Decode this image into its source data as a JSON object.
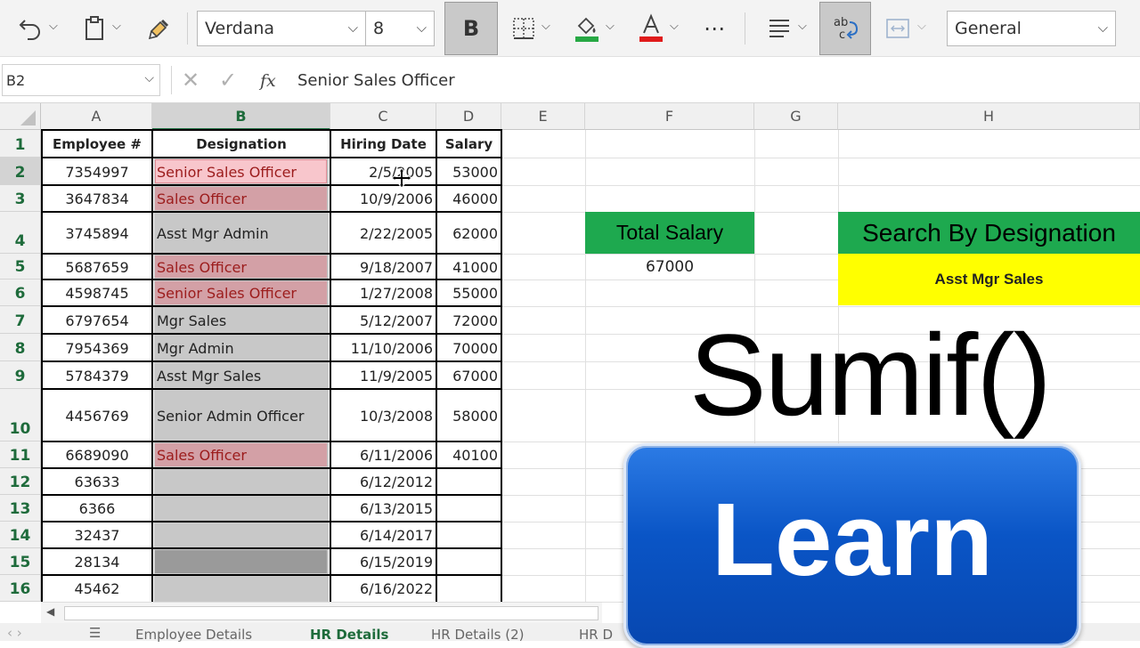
{
  "toolbar": {
    "font_name": "Verdana",
    "font_size": "8",
    "bold_label": "B",
    "number_format": "General",
    "font_color": "#e01b1b",
    "fill_color": "#27a844",
    "more_label": "⋯"
  },
  "formula_bar": {
    "name_box": "B2",
    "fx_label": "fx",
    "content": "Senior Sales Officer"
  },
  "columns": [
    "A",
    "B",
    "C",
    "D",
    "E",
    "F",
    "G",
    "H"
  ],
  "rows": [
    "1",
    "2",
    "3",
    "4",
    "5",
    "6",
    "7",
    "8",
    "9",
    "10",
    "11",
    "12",
    "13",
    "14",
    "15",
    "16"
  ],
  "table": {
    "headers": [
      "Employee #",
      "Designation",
      "Hiring Date",
      "Salary"
    ],
    "data": [
      [
        "7354997",
        "Senior Sales Officer",
        "2/5/2005",
        "53000"
      ],
      [
        "3647834",
        "Sales Officer",
        "10/9/2006",
        "46000"
      ],
      [
        "3745894",
        "Asst Mgr Admin",
        "2/22/2005",
        "62000"
      ],
      [
        "5687659",
        "Sales Officer",
        "9/18/2007",
        "41000"
      ],
      [
        "4598745",
        "Senior Sales Officer",
        "1/27/2008",
        "55000"
      ],
      [
        "6797654",
        "Mgr Sales",
        "5/12/2007",
        "72000"
      ],
      [
        "7954369",
        "Mgr Admin",
        "11/10/2006",
        "70000"
      ],
      [
        "5784379",
        "Asst Mgr Sales",
        "11/9/2005",
        "67000"
      ],
      [
        "4456769",
        "Senior Admin Officer",
        "10/3/2008",
        "58000"
      ],
      [
        "6689090",
        "Sales Officer",
        "6/11/2006",
        "40100"
      ],
      [
        "63633",
        "",
        "6/12/2012",
        ""
      ],
      [
        "6366",
        "",
        "6/13/2015",
        ""
      ],
      [
        "32437",
        "",
        "6/14/2017",
        ""
      ],
      [
        "28134",
        "",
        "6/15/2019",
        ""
      ],
      [
        "45462",
        "",
        "6/16/2022",
        ""
      ]
    ]
  },
  "summary": {
    "total_salary_label": "Total Salary",
    "total_salary_value": "67000",
    "search_label": "Search By Designation",
    "search_value": "Asst Mgr Sales"
  },
  "overlay": {
    "title": "Sumif()",
    "learn_label": "Learn"
  },
  "sheet_tabs": [
    "Employee Details",
    "HR Details",
    "HR Details (2)",
    "HR D"
  ],
  "colors": {
    "header_green": "#1e6b3b",
    "total_salary_bg": "#1ea94f",
    "search_value_bg": "#ffff00",
    "learn_blue": "#0a55c6"
  }
}
